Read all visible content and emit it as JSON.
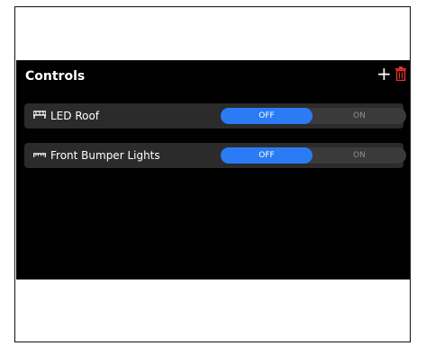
{
  "panel": {
    "title": "Controls",
    "add_icon": "plus-icon",
    "delete_icon": "trash-icon",
    "delete_color": "#e8342b"
  },
  "controls": [
    {
      "label": "LED Roof",
      "icon": "led-bar-icon",
      "off_label": "OFF",
      "on_label": "ON",
      "state": "OFF"
    },
    {
      "label": "Front Bumper Lights",
      "icon": "light-strip-icon",
      "off_label": "OFF",
      "on_label": "ON",
      "state": "OFF"
    }
  ],
  "colors": {
    "accent": "#2b7bf5",
    "panel_bg": "#000000",
    "row_bg": "#2b2b2b"
  }
}
